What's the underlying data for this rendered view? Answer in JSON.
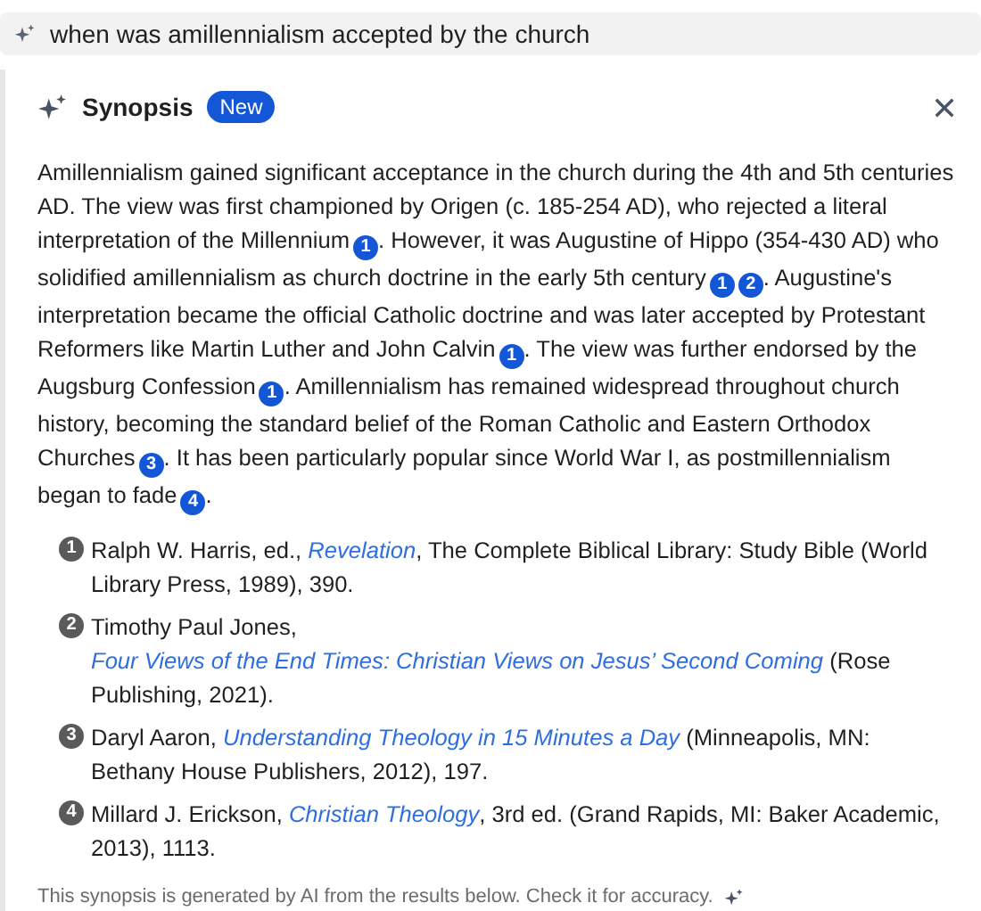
{
  "query": "when was amillennialism accepted by the church",
  "synopsis": {
    "title": "Synopsis",
    "badge": "New",
    "paragraph": [
      {
        "kind": "text",
        "text": "Amillennialism gained significant acceptance in the church during the 4th and 5th centuries AD. The view was first championed by Origen (c. 185-254 AD), who rejected a literal interpretation of the Millennium"
      },
      {
        "kind": "cite",
        "text": "1"
      },
      {
        "kind": "text",
        "text": ". However, it was Augustine of Hippo (354-430 AD) who solidified amillennialism as church doctrine in the early 5th century"
      },
      {
        "kind": "cite",
        "text": "1"
      },
      {
        "kind": "cite",
        "text": "2"
      },
      {
        "kind": "text",
        "text": ". Augustine's interpretation became the official Catholic doctrine and was later accepted by Protestant Reformers like Martin Luther and John Calvin"
      },
      {
        "kind": "cite",
        "text": "1"
      },
      {
        "kind": "text",
        "text": ". The view was further endorsed by the Augsburg Confession"
      },
      {
        "kind": "cite",
        "text": "1"
      },
      {
        "kind": "text",
        "text": ". Amillennialism has remained widespread throughout church history, becoming the standard belief of the Roman Catholic and Eastern Orthodox Churches"
      },
      {
        "kind": "cite",
        "text": "3"
      },
      {
        "kind": "text",
        "text": ". It has been particularly popular since World War I, as postmillennialism began to fade"
      },
      {
        "kind": "cite",
        "text": "4"
      },
      {
        "kind": "text",
        "text": "."
      }
    ],
    "references": [
      {
        "number": "1",
        "parts": [
          {
            "kind": "text",
            "text": "Ralph W. Harris, ed., "
          },
          {
            "kind": "link",
            "text": "Revelation"
          },
          {
            "kind": "text",
            "text": ", The Complete Biblical Library: Study Bible (World Library Press, 1989), 390."
          }
        ]
      },
      {
        "number": "2",
        "parts": [
          {
            "kind": "text",
            "text": "Timothy Paul Jones, "
          },
          {
            "kind": "link",
            "text": "Four Views of the End Times: Christian Views on Jesus’ Second Coming"
          },
          {
            "kind": "text",
            "text": " (Rose Publishing, 2021)."
          }
        ]
      },
      {
        "number": "3",
        "parts": [
          {
            "kind": "text",
            "text": "Daryl Aaron, "
          },
          {
            "kind": "link",
            "text": "Understanding Theology in 15 Minutes a Day"
          },
          {
            "kind": "text",
            "text": " (Minneapolis, MN: Bethany House Publishers, 2012), 197."
          }
        ]
      },
      {
        "number": "4",
        "parts": [
          {
            "kind": "text",
            "text": "Millard J. Erickson, "
          },
          {
            "kind": "link",
            "text": "Christian Theology"
          },
          {
            "kind": "text",
            "text": ", 3rd ed. (Grand Rapids, MI: Baker Academic, 2013), 1113."
          }
        ]
      }
    ],
    "disclaimer": "This synopsis is generated by AI from the results below. Check it for accuracy."
  }
}
